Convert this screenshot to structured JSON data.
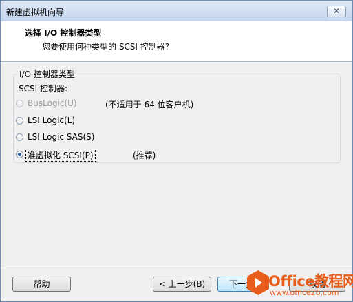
{
  "window": {
    "title": "新建虚拟机向导",
    "close_label": "✕"
  },
  "header": {
    "title": "选择 I/O 控制器类型",
    "subtitle": "您要使用何种类型的 SCSI 控制器?"
  },
  "group": {
    "legend": "I/O 控制器类型",
    "sublabel": "SCSI 控制器:",
    "options": [
      {
        "label": "BusLogic(U)",
        "note": "(不适用于 64 位客户机)",
        "selected": false,
        "disabled": true
      },
      {
        "label": "LSI Logic(L)",
        "note": "",
        "selected": false,
        "disabled": false
      },
      {
        "label": "LSI Logic SAS(S)",
        "note": "",
        "selected": false,
        "disabled": false
      },
      {
        "label": "准虚拟化 SCSI(P)",
        "note": "(推荐)",
        "selected": true,
        "disabled": false
      }
    ]
  },
  "buttons": {
    "help": "帮助",
    "back": "< 上一步(B)",
    "next": "下一步",
    "cancel": "取消"
  },
  "watermark": {
    "brand": "Office教程网",
    "url": "www.office26.com",
    "logo_color": "#e85d1c"
  }
}
